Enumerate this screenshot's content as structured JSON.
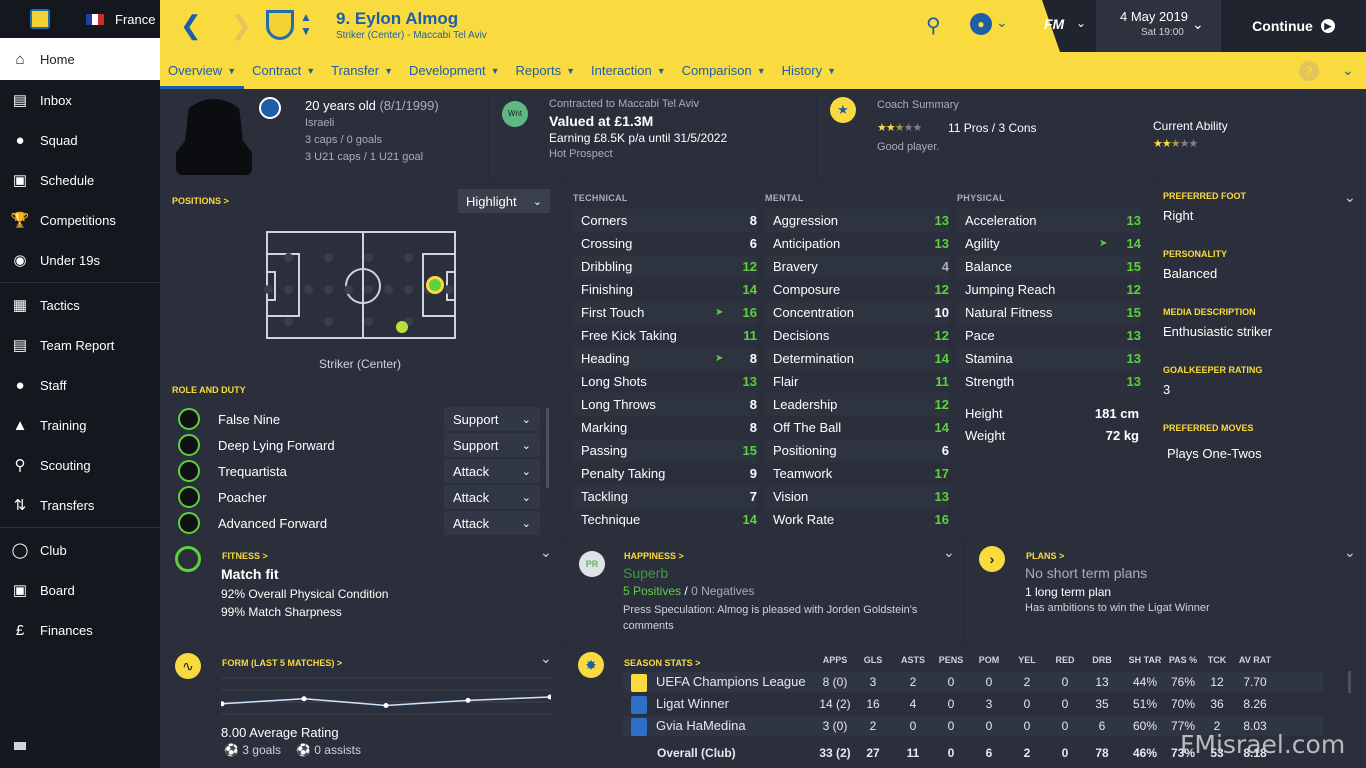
{
  "sidebar": {
    "country": "France",
    "items": [
      {
        "label": "Home",
        "icon": "home-icon"
      },
      {
        "label": "Inbox",
        "icon": "inbox-icon"
      },
      {
        "label": "Squad",
        "icon": "squad-icon"
      },
      {
        "label": "Schedule",
        "icon": "schedule-icon"
      },
      {
        "label": "Competitions",
        "icon": "trophy-icon"
      },
      {
        "label": "Under 19s",
        "icon": "u19-icon"
      },
      {
        "label": "Tactics",
        "icon": "tactics-icon"
      },
      {
        "label": "Team Report",
        "icon": "team-report-icon"
      },
      {
        "label": "Staff",
        "icon": "staff-icon"
      },
      {
        "label": "Training",
        "icon": "training-icon"
      },
      {
        "label": "Scouting",
        "icon": "scouting-icon"
      },
      {
        "label": "Transfers",
        "icon": "transfers-icon"
      },
      {
        "label": "Club",
        "icon": "club-icon"
      },
      {
        "label": "Board",
        "icon": "board-icon"
      },
      {
        "label": "Finances",
        "icon": "finances-icon"
      }
    ]
  },
  "header": {
    "player_name": "9. Eylon Almog",
    "player_role": "Striker (Center) - Maccabi Tel Aviv",
    "date": "4 May 2019",
    "day_time": "Sat 19:00",
    "continue_label": "Continue",
    "fm_logo": "FM"
  },
  "tabs": [
    "Overview",
    "Contract",
    "Transfer",
    "Development",
    "Reports",
    "Interaction",
    "Comparison",
    "History"
  ],
  "profile": {
    "age": "20 years old",
    "dob": "(8/1/1999)",
    "nationality": "Israeli",
    "caps": "3 caps / 0 goals",
    "u21_caps": "3 U21 caps / 1 U21 goal"
  },
  "contract": {
    "badge": "Wnt",
    "contracted_to": "Contracted to Maccabi Tel Aviv",
    "value": "Valued at £1.3M",
    "earning": "Earning £8.5K p/a until 31/5/2022",
    "status": "Hot Prospect"
  },
  "coach": {
    "title": "Coach Summary",
    "pros_cons": "11 Pros / 3 Cons",
    "verdict": "Good player.",
    "current_ability_label": "Current Ability",
    "potential_stars": 2.5,
    "ability_stars": 2.5
  },
  "positions": {
    "label": "POSITIONS >",
    "highlight_label": "Highlight",
    "position_name": "Striker (Center)",
    "role_duty_label": "ROLE AND DUTY",
    "roles": [
      {
        "name": "False Nine",
        "duty": "Support"
      },
      {
        "name": "Deep Lying Forward",
        "duty": "Support"
      },
      {
        "name": "Trequartista",
        "duty": "Attack"
      },
      {
        "name": "Poacher",
        "duty": "Attack"
      },
      {
        "name": "Advanced Forward",
        "duty": "Attack"
      }
    ]
  },
  "attributes": {
    "technical_label": "TECHNICAL",
    "mental_label": "MENTAL",
    "physical_label": "PHYSICAL",
    "technical": [
      {
        "name": "Corners",
        "value": "8",
        "color": "w"
      },
      {
        "name": "Crossing",
        "value": "6",
        "color": "w"
      },
      {
        "name": "Dribbling",
        "value": "12",
        "color": "g"
      },
      {
        "name": "Finishing",
        "value": "14",
        "color": "g"
      },
      {
        "name": "First Touch",
        "value": "16",
        "color": "g",
        "arrow": true
      },
      {
        "name": "Free Kick Taking",
        "value": "11",
        "color": "g"
      },
      {
        "name": "Heading",
        "value": "8",
        "color": "w",
        "arrow": true
      },
      {
        "name": "Long Shots",
        "value": "13",
        "color": "g"
      },
      {
        "name": "Long Throws",
        "value": "8",
        "color": "w"
      },
      {
        "name": "Marking",
        "value": "8",
        "color": "w"
      },
      {
        "name": "Passing",
        "value": "15",
        "color": "g"
      },
      {
        "name": "Penalty Taking",
        "value": "9",
        "color": "w"
      },
      {
        "name": "Tackling",
        "value": "7",
        "color": "w"
      },
      {
        "name": "Technique",
        "value": "14",
        "color": "g"
      }
    ],
    "mental": [
      {
        "name": "Aggression",
        "value": "13",
        "color": "g"
      },
      {
        "name": "Anticipation",
        "value": "13",
        "color": "g"
      },
      {
        "name": "Bravery",
        "value": "4",
        "color": "gr"
      },
      {
        "name": "Composure",
        "value": "12",
        "color": "g"
      },
      {
        "name": "Concentration",
        "value": "10",
        "color": "w"
      },
      {
        "name": "Decisions",
        "value": "12",
        "color": "g"
      },
      {
        "name": "Determination",
        "value": "14",
        "color": "g"
      },
      {
        "name": "Flair",
        "value": "11",
        "color": "g"
      },
      {
        "name": "Leadership",
        "value": "12",
        "color": "g"
      },
      {
        "name": "Off The Ball",
        "value": "14",
        "color": "g"
      },
      {
        "name": "Positioning",
        "value": "6",
        "color": "w"
      },
      {
        "name": "Teamwork",
        "value": "17",
        "color": "g"
      },
      {
        "name": "Vision",
        "value": "13",
        "color": "g"
      },
      {
        "name": "Work Rate",
        "value": "16",
        "color": "g"
      }
    ],
    "physical": [
      {
        "name": "Acceleration",
        "value": "13",
        "color": "g"
      },
      {
        "name": "Agility",
        "value": "14",
        "color": "g",
        "arrow": true
      },
      {
        "name": "Balance",
        "value": "15",
        "color": "g"
      },
      {
        "name": "Jumping Reach",
        "value": "12",
        "color": "g"
      },
      {
        "name": "Natural Fitness",
        "value": "15",
        "color": "g"
      },
      {
        "name": "Pace",
        "value": "13",
        "color": "g"
      },
      {
        "name": "Stamina",
        "value": "13",
        "color": "g"
      },
      {
        "name": "Strength",
        "value": "13",
        "color": "g"
      }
    ],
    "height_label": "Height",
    "height": "181 cm",
    "weight_label": "Weight",
    "weight": "72 kg"
  },
  "info": {
    "preferred_foot_label": "PREFERRED FOOT",
    "preferred_foot": "Right",
    "personality_label": "PERSONALITY",
    "personality": "Balanced",
    "media_label": "MEDIA DESCRIPTION",
    "media": "Enthusiastic striker",
    "gk_label": "GOALKEEPER RATING",
    "gk": "3",
    "moves_label": "PREFERRED MOVES",
    "moves": "Plays One-Twos"
  },
  "fitness": {
    "label": "FITNESS >",
    "status": "Match fit",
    "condition": "92% Overall Physical Condition",
    "sharpness": "99% Match Sharpness"
  },
  "happiness": {
    "label": "HAPPINESS >",
    "badge": "PR",
    "status": "Superb",
    "positives": "5 Positives",
    "sep": "/",
    "negatives": "0 Negatives",
    "note": "Press Speculation: Almog is pleased with Jorden Goldstein's comments"
  },
  "plans": {
    "label": "PLANS >",
    "none": "No short term plans",
    "long": "1 long term plan",
    "desc": "Has ambitions to win the Ligat Winner"
  },
  "form": {
    "label": "FORM (LAST 5 MATCHES) >",
    "avg": "8.00 Average Rating",
    "goals": "3 goals",
    "assists": "0 assists",
    "ratings": [
      7.6,
      7.9,
      7.5,
      7.8,
      8.0
    ]
  },
  "season_stats": {
    "label": "SEASON STATS >",
    "headers": [
      "APPS",
      "GLS",
      "ASTS",
      "PENS",
      "POM",
      "YEL",
      "RED",
      "DRB",
      "SH TAR",
      "PAS %",
      "TCK",
      "AV RAT"
    ],
    "rows": [
      {
        "comp": "UEFA Champions League",
        "cells": [
          "8 (0)",
          "3",
          "2",
          "0",
          "0",
          "2",
          "0",
          "13",
          "44%",
          "76%",
          "12",
          "7.70"
        ]
      },
      {
        "comp": "Ligat Winner",
        "cells": [
          "14 (2)",
          "16",
          "4",
          "0",
          "3",
          "0",
          "0",
          "35",
          "51%",
          "70%",
          "36",
          "8.26"
        ]
      },
      {
        "comp": "Gvia HaMedina",
        "cells": [
          "3 (0)",
          "2",
          "0",
          "0",
          "0",
          "0",
          "0",
          "6",
          "60%",
          "77%",
          "2",
          "8.03"
        ]
      }
    ],
    "overall": {
      "comp": "Overall (Club)",
      "cells": [
        "33 (2)",
        "27",
        "11",
        "0",
        "6",
        "2",
        "0",
        "78",
        "46%",
        "73%",
        "53",
        "8.18"
      ]
    }
  },
  "watermark": "FMisrael.com",
  "colors": {
    "accent": "#f9db3f",
    "brand_blue": "#1e5ea8",
    "good": "#5cd13d"
  }
}
